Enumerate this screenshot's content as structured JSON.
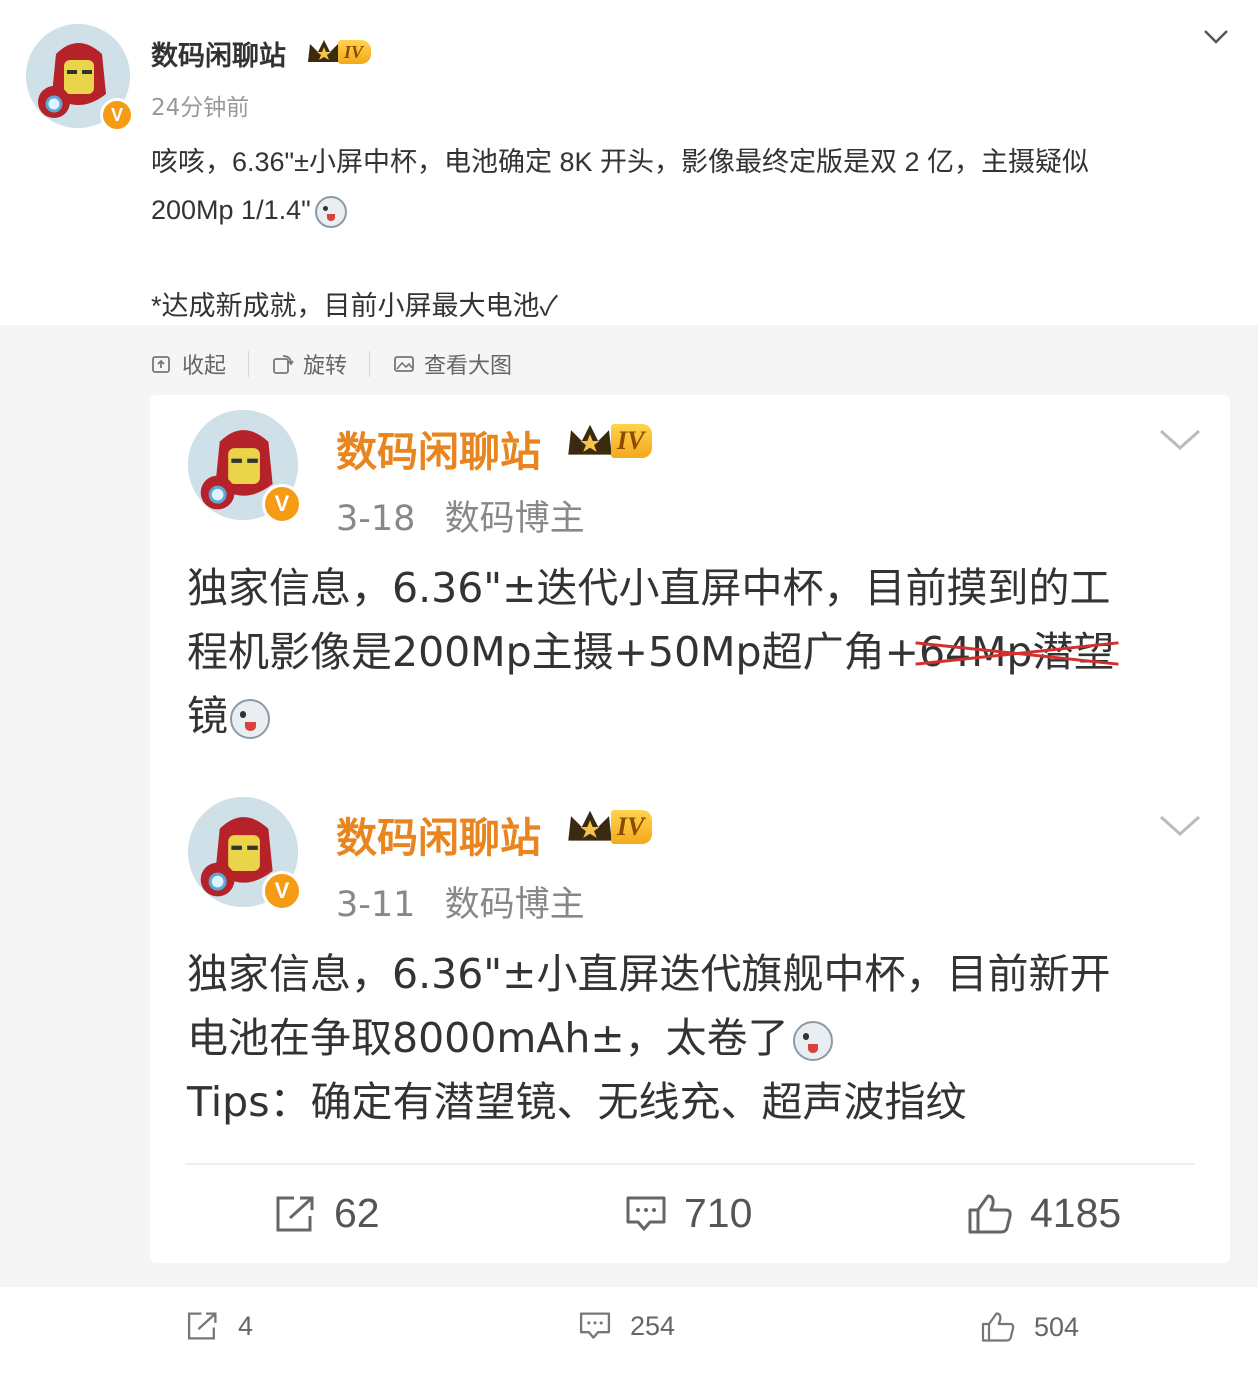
{
  "post": {
    "author": "数码闲聊站",
    "level": "IV",
    "time": "24分钟前",
    "lines": [
      "咳咳，6.36\"±小屏中杯，电池确定 8K 开头，影像最终定版是双 2 亿，主摄疑似",
      "200Mp 1/1.4\"",
      "",
      "*达成新成就，目前小屏最大电池✓"
    ]
  },
  "toolbar": {
    "collapse": "收起",
    "rotate": "旋转",
    "view_large": "查看大图"
  },
  "quoted": [
    {
      "author": "数码闲聊站",
      "level": "IV",
      "date": "3-18",
      "role": "数码博主",
      "line1": "独家信息，6.36\"±迭代小直屏中杯，目前摸到的工",
      "line2_pre": "程机影像是200Mp主摄+50Mp超广角+",
      "line2_strike": "64Mp潜望",
      "line3": "镜"
    },
    {
      "author": "数码闲聊站",
      "level": "IV",
      "date": "3-11",
      "role": "数码博主",
      "line1": "独家信息，6.36\"±小直屏迭代旗舰中杯，目前新开",
      "line2": "电池在争取8000mAh±，太卷了",
      "line3": "Tips：确定有潜望镜、无线充、超声波指纹"
    }
  ],
  "card_actions": {
    "reposts": "62",
    "comments": "710",
    "likes": "4185"
  },
  "footer_actions": {
    "reposts": "4",
    "comments": "254",
    "likes": "504"
  },
  "colors": {
    "accent": "#e8851f",
    "vip_badge": "#f59b14",
    "strike": "#d32f2f"
  }
}
